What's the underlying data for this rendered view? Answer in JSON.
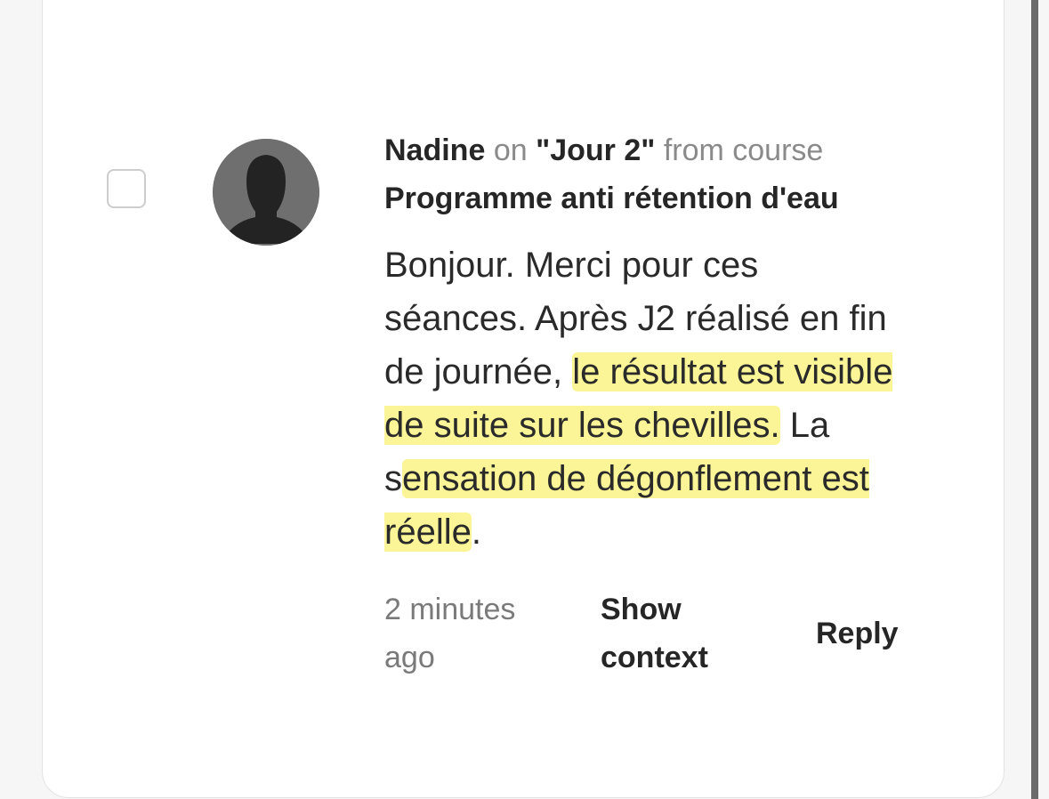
{
  "comment": {
    "author": "Nadine",
    "on_text": "on",
    "lesson": "\"Jour 2\"",
    "from_text": "from course",
    "course": "Programme anti rétention d'eau",
    "body": {
      "part1": "Bonjour. Merci pour ces séances. Après J2 réalisé en fin de journée, ",
      "highlight1": "le résultat est visible de suite sur les chevilles.",
      "part2": " La s",
      "highlight2": "ensation de dégonflement est réelle",
      "part3": "."
    },
    "time": "2 minutes ago",
    "show_context_label": "Show context",
    "reply_label": "Reply"
  },
  "colors": {
    "highlight": "#fbf597",
    "card_background": "#ffffff",
    "page_background": "#f6f6f6"
  },
  "icons": {
    "avatar": "default-user-silhouette-icon",
    "checkbox": "unchecked-checkbox"
  }
}
